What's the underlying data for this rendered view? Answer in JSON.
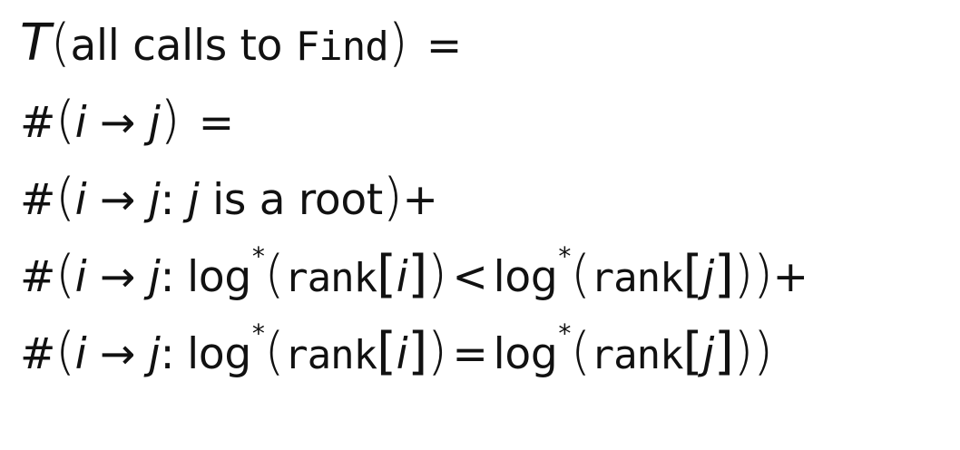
{
  "lines": {
    "l1": {
      "T": "T",
      "open": "(",
      "text": "all calls to ",
      "fn": "Find",
      "close": ")",
      "eq": " ="
    },
    "l2": {
      "hash": "#",
      "open": "(",
      "i": "i",
      "arrow": " → ",
      "j": "j",
      "close": ")",
      "eq": " ="
    },
    "l3": {
      "hash": "#",
      "open": "(",
      "i": "i",
      "arrow": " → ",
      "j": "j",
      "colon": ": ",
      "j2": "j",
      "text": " is a root",
      "close": ")",
      "plus": "+"
    },
    "l4": {
      "hash": "#",
      "open": "(",
      "i": "i",
      "arrow": " → ",
      "j": "j",
      "colon": ":",
      "log1": "log",
      "star1": "*",
      "open2": "(",
      "rank1": "rank",
      "br1o": "[",
      "i2": "i",
      "br1c": "]",
      "close2": ")",
      "op": "<",
      "log2": "log",
      "star2": "*",
      "open3": "(",
      "rank2": "rank",
      "br2o": "[",
      "j2": "j",
      "br2c": "]",
      "close3": "))",
      "plus": "+"
    },
    "l5": {
      "hash": "#",
      "open": "(",
      "i": "i",
      "arrow": " → ",
      "j": "j",
      "colon": ":",
      "log1": "log",
      "star1": "*",
      "open2": "(",
      "rank1": "rank",
      "br1o": "[",
      "i2": "i",
      "br1c": "]",
      "close2": ")",
      "op": "=",
      "log2": "log",
      "star2": "*",
      "open3": "(",
      "rank2": "rank",
      "br2o": "[",
      "j2": "j",
      "br2c": "]",
      "close3": "))"
    }
  }
}
